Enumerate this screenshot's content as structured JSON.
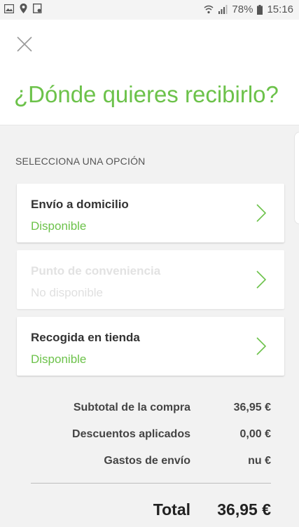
{
  "status_bar": {
    "battery": "78%",
    "time": "15:16"
  },
  "header": {
    "close_icon": "close-icon",
    "title": "¿Dónde quieres recibirlo?"
  },
  "section_label": "SELECCIONA UNA OPCIÓN",
  "options": [
    {
      "title": "Envío a domicilio",
      "status": "Disponible",
      "enabled": true
    },
    {
      "title": "Punto de conveniencia",
      "status": "No disponible",
      "enabled": false
    },
    {
      "title": "Recogida en tienda",
      "status": "Disponible",
      "enabled": true
    }
  ],
  "summary": {
    "subtotal_label": "Subtotal de la compra",
    "subtotal_value": "36,95 €",
    "discount_label": "Descuentos aplicados",
    "discount_value": "0,00 €",
    "shipping_label": "Gastos de envío",
    "shipping_value": "nu €",
    "total_label": "Total",
    "total_value": "36,95 €"
  },
  "colors": {
    "accent": "#6cc24a",
    "text": "#333333",
    "disabled": "#e0e0e0",
    "background": "#f2f2f2"
  }
}
